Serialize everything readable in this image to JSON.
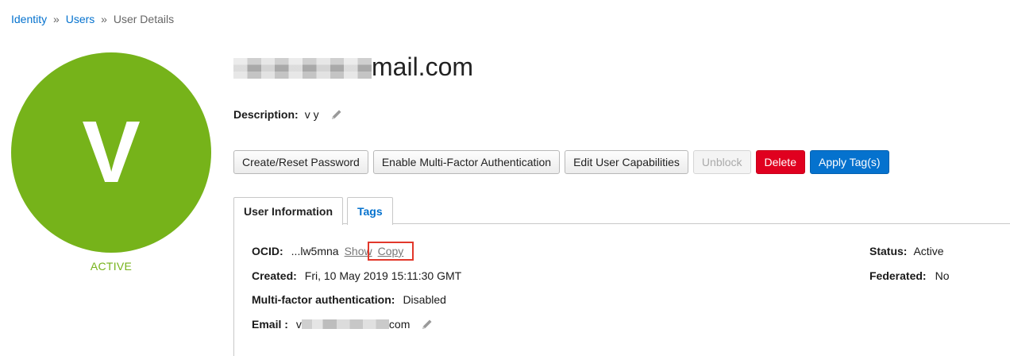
{
  "breadcrumb": {
    "items": [
      "Identity",
      "Users"
    ],
    "separator": "»",
    "current": "User Details"
  },
  "avatar": {
    "initial": "V",
    "status": "ACTIVE",
    "color": "#76b31a"
  },
  "user": {
    "title_suffix": "mail.com",
    "description_label": "Description:",
    "description_value": "v y"
  },
  "actions": {
    "create_reset_password": "Create/Reset Password",
    "enable_mfa": "Enable Multi-Factor Authentication",
    "edit_capabilities": "Edit User Capabilities",
    "unblock": "Unblock",
    "delete": "Delete",
    "apply_tags": "Apply Tag(s)"
  },
  "tabs": {
    "user_information": "User Information",
    "tags": "Tags"
  },
  "info": {
    "ocid_label": "OCID:",
    "ocid_value": "...lw5mna",
    "show_link": "Show",
    "copy_link": "Copy",
    "created_label": "Created:",
    "created_value": "Fri, 10 May 2019 15:11:30 GMT",
    "mfa_label": "Multi-factor authentication:",
    "mfa_value": "Disabled",
    "email_label": "Email :",
    "email_prefix": "v",
    "email_suffix": "com",
    "status_label": "Status:",
    "status_value": "Active",
    "federated_label": "Federated:",
    "federated_value": "No"
  },
  "colors": {
    "link": "#0572ce",
    "danger": "#e0001f",
    "primary": "#0572ce",
    "highlight": "#e2382b"
  }
}
